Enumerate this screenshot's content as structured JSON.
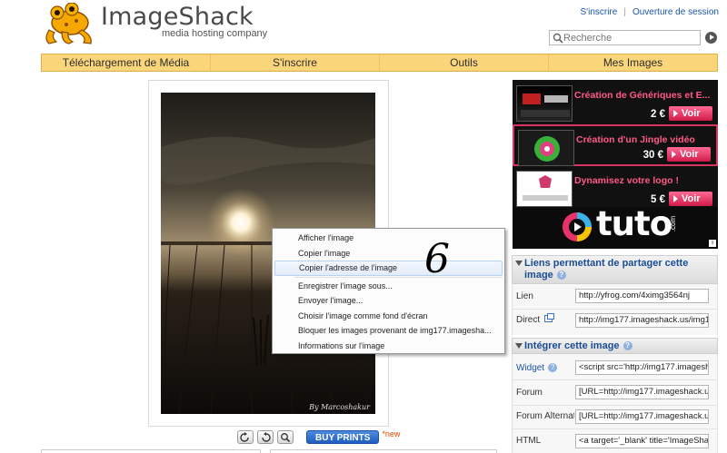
{
  "header": {
    "brand": "ImageShack",
    "tagline": "media hosting company",
    "link_signup": "S'inscrire",
    "link_separator": "|",
    "link_login": "Ouverture de session",
    "search_placeholder": "Recherche"
  },
  "nav": {
    "tabs": [
      "Téléchargement de Média",
      "S'inscrire",
      "Outils",
      "Mes Images"
    ]
  },
  "photo": {
    "watermark": "By Marcoshakur"
  },
  "toolbar": {
    "buy_prints": "BUY PRINTS",
    "new_badge": "*new"
  },
  "context_menu": {
    "items": [
      "Afficher l'image",
      "Copier l'image",
      "Copier l'adresse de l'image",
      "Enregistrer l'image sous...",
      "Envoyer l'image...",
      "Choisir l'image comme fond d'écran",
      "Bloquer les images provenant de img177.imagesha...",
      "Informations sur l'image"
    ],
    "highlighted_index": 2,
    "step_number": "6"
  },
  "ads": {
    "items": [
      {
        "title": "Création de Génériques et E...",
        "price": "2 €",
        "button": "Voir"
      },
      {
        "title": "Création d'un Jingle vidéo",
        "price": "30 €",
        "button": "Voir"
      },
      {
        "title": "Dynamisez votre logo !",
        "price": "5 €",
        "button": "Voir"
      }
    ],
    "selected_index": 1,
    "banner_text": "tuto",
    "banner_suffix": ".com",
    "info_icon": "i"
  },
  "share_links": {
    "title": "Liens permettant de partager cette image",
    "help": "?",
    "rows": [
      {
        "label": "Lien",
        "value": "http://yfrog.com/4ximg3564nj"
      },
      {
        "label": "Direct",
        "value": "http://img177.imageshack.us/img1"
      }
    ]
  },
  "embed": {
    "title": "Intégrer cette image",
    "help": "?",
    "rows": [
      {
        "label": "Widget",
        "value": "<script src='http://img177.imagesh"
      },
      {
        "label": "Forum",
        "value": "[URL=http://img177.imageshack.u"
      },
      {
        "label": "Forum Alternatif",
        "value": "[URL=http://img177.imageshack.u"
      },
      {
        "label": "HTML",
        "value": "<a target='_blank' title='ImageShac"
      }
    ]
  },
  "colors": {
    "nav_bg": "#fbd57a",
    "link_blue": "#1a55a5",
    "ad_pink": "#ff5a88",
    "buy_blue": "#1f5ec1"
  }
}
